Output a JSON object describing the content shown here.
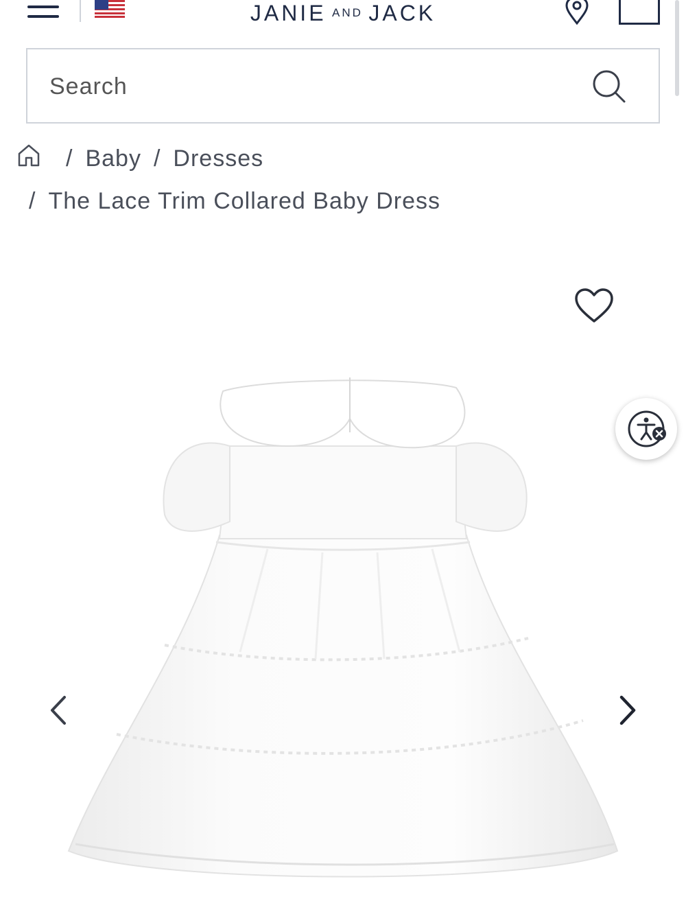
{
  "header": {
    "logo_left": "JANIE",
    "logo_mid": "AND",
    "logo_right": "JACK",
    "icons": [
      "hamburger-menu-icon",
      "us-flag-icon",
      "location-pin-icon",
      "shopping-bag-icon"
    ]
  },
  "search": {
    "placeholder": "Search",
    "icon": "search-icon"
  },
  "breadcrumb": {
    "home_icon": "home-icon",
    "separator": "/",
    "items": [
      "Baby",
      "Dresses",
      "The Lace Trim Collared Baby Dress"
    ]
  },
  "gallery": {
    "icons": [
      "heart-icon",
      "accessibility-icon",
      "chevron-left-icon",
      "chevron-right-icon"
    ],
    "image_alt": "white collared baby dress with lace trim"
  },
  "colors": {
    "navy": "#1f2a44",
    "text_gray": "#4a4f5a",
    "border_gray": "#cfd3da"
  }
}
